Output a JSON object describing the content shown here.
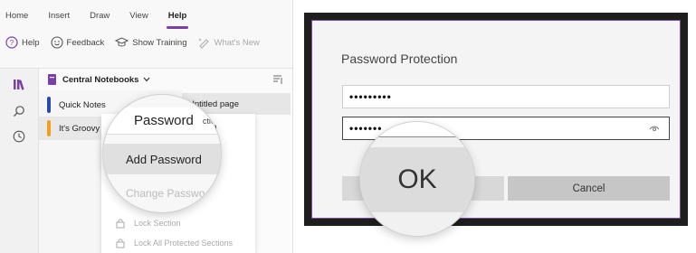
{
  "left": {
    "tabs": [
      "Home",
      "Insert",
      "Draw",
      "View",
      "Help"
    ],
    "active_tab": "Help",
    "toolbar": {
      "help": "Help",
      "feedback": "Feedback",
      "show_training": "Show Training",
      "whats_new": "What's New"
    },
    "notebook": "Central Notebooks",
    "sections": [
      {
        "label": "Quick Notes",
        "color": "#2b4aa8"
      },
      {
        "label": "It's Groovy",
        "color": "#f0a020"
      }
    ],
    "page": "Untitled page",
    "context_menu": {
      "header": "Password Protection",
      "items": [
        "Add Password",
        "Change Password",
        "Lock Section",
        "Lock All Protected Sections"
      ]
    },
    "zoom": {
      "header": "Password",
      "suffix": "ction",
      "add": "Add Password",
      "change": "Change Passwo"
    },
    "accent": "#7b3fa8"
  },
  "dialog": {
    "title": "Password Protection",
    "password": "•••••••••",
    "confirm": "•••••••",
    "ok": "OK",
    "cancel": "Cancel",
    "border_color": "#7a4aa8"
  }
}
